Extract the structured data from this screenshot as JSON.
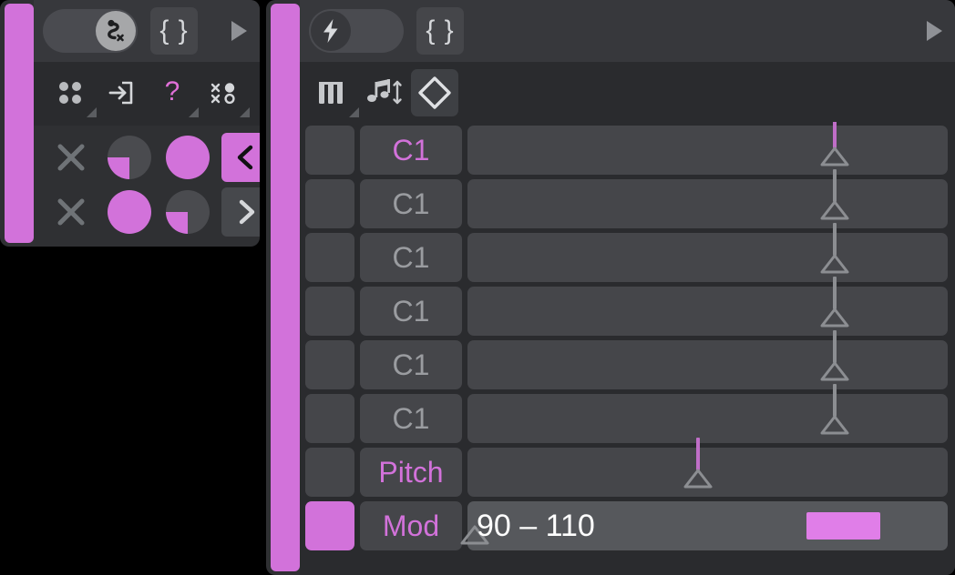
{
  "theme": {
    "accent": "#d272da",
    "accent_bright": "#e07ee8",
    "panel_bg": "#2f3033",
    "topbar_bg": "#37383c",
    "body_bg": "#2a2b2e",
    "cell_bg": "#45464a",
    "track_light": "#56585c",
    "text_muted": "#9a9ca0",
    "text_white": "#ffffff",
    "page_bg": "#000000"
  },
  "left_panel": {
    "name": "left-panel",
    "toggle": {
      "state": "on",
      "icon": "route-path-x-icon",
      "label": "Route Off"
    },
    "brace_button": {
      "label": "{ }",
      "icon": "curly-braces-icon"
    },
    "play_button": {
      "icon": "play-triangle-icon"
    },
    "tools": [
      {
        "icon": "four-dots-grid-icon",
        "has_corner_menu": true,
        "color": "#b9bbbe",
        "name": "grid-tool"
      },
      {
        "icon": "import-arrow-into-box-icon",
        "has_corner_menu": false,
        "color": "#d5d7da",
        "name": "import-tool"
      },
      {
        "icon": "question-mark-icon",
        "has_corner_menu": true,
        "color": "#e070d8",
        "name": "help-tool"
      },
      {
        "icon": "random-shapes-icon",
        "has_corner_menu": true,
        "color": "#d5d7da",
        "name": "randomize-tool"
      }
    ],
    "cards": [
      {
        "row_name": "card-row-1",
        "cells": [
          {
            "icon": "x-close-icon",
            "style": "plain",
            "name": "clear-cell-1"
          },
          {
            "icon": "pie-quarter-icon",
            "style": "pie-quarter",
            "name": "pie-cell-1"
          },
          {
            "icon": "circle-full-icon",
            "style": "circle-full",
            "name": "circle-cell-1"
          },
          {
            "icon": "chevron-left-icon",
            "style": "filled-accent",
            "name": "prev-button"
          }
        ]
      },
      {
        "row_name": "card-row-2",
        "cells": [
          {
            "icon": "x-close-icon",
            "style": "plain",
            "name": "clear-cell-2"
          },
          {
            "icon": "circle-full-icon",
            "style": "circle-full",
            "name": "circle-cell-2"
          },
          {
            "icon": "pie-quarter-icon",
            "style": "pie-quarter",
            "name": "pie-cell-2"
          },
          {
            "icon": "chevron-right-icon",
            "style": "filled-dark",
            "name": "next-button"
          }
        ]
      }
    ]
  },
  "right_panel": {
    "name": "right-panel",
    "toggle": {
      "state": "off",
      "icon": "lightning-bolt-icon",
      "label": "Trigger"
    },
    "brace_button": {
      "label": "{ }",
      "icon": "curly-braces-icon"
    },
    "play_button": {
      "icon": "play-triangle-icon"
    },
    "tools": [
      {
        "icon": "piano-keys-icon",
        "has_corner_menu": true,
        "selected": false,
        "name": "piano-keys-tool"
      },
      {
        "icon": "note-transpose-icon",
        "has_corner_menu": false,
        "selected": false,
        "name": "note-transpose-tool"
      },
      {
        "icon": "diamond-outline-icon",
        "has_corner_menu": false,
        "selected": true,
        "name": "velocity-range-tool"
      }
    ],
    "rows": [
      {
        "name": "row-c1-1",
        "swatch": "dark",
        "label": "C1",
        "label_active": true,
        "handle_pct": 76.5,
        "handle_accent": true,
        "handle_short": false,
        "value_text": "",
        "bar": null
      },
      {
        "name": "row-c1-2",
        "swatch": "dark",
        "label": "C1",
        "label_active": false,
        "handle_pct": 76.5,
        "handle_accent": false,
        "handle_short": false,
        "value_text": "",
        "bar": null
      },
      {
        "name": "row-c1-3",
        "swatch": "dark",
        "label": "C1",
        "label_active": false,
        "handle_pct": 76.5,
        "handle_accent": false,
        "handle_short": false,
        "value_text": "",
        "bar": null
      },
      {
        "name": "row-c1-4",
        "swatch": "dark",
        "label": "C1",
        "label_active": false,
        "handle_pct": 76.5,
        "handle_accent": false,
        "handle_short": false,
        "value_text": "",
        "bar": null
      },
      {
        "name": "row-c1-5",
        "swatch": "dark",
        "label": "C1",
        "label_active": false,
        "handle_pct": 76.5,
        "handle_accent": false,
        "handle_short": false,
        "value_text": "",
        "bar": null
      },
      {
        "name": "row-c1-6",
        "swatch": "dark",
        "label": "C1",
        "label_active": false,
        "handle_pct": 76.5,
        "handle_accent": false,
        "handle_short": false,
        "value_text": "",
        "bar": null
      },
      {
        "name": "row-pitch",
        "swatch": "dark",
        "label": "Pitch",
        "label_active": true,
        "handle_pct": 48.0,
        "handle_accent": true,
        "handle_short": false,
        "value_text": "",
        "bar": null
      },
      {
        "name": "row-mod",
        "swatch": "accent",
        "label": "Mod",
        "label_active": true,
        "handle_pct": 1.5,
        "handle_accent": false,
        "handle_short": true,
        "value_text": "90 – 110",
        "bar": {
          "left_pct": 70.5,
          "width_pct": 15.5
        }
      }
    ]
  }
}
